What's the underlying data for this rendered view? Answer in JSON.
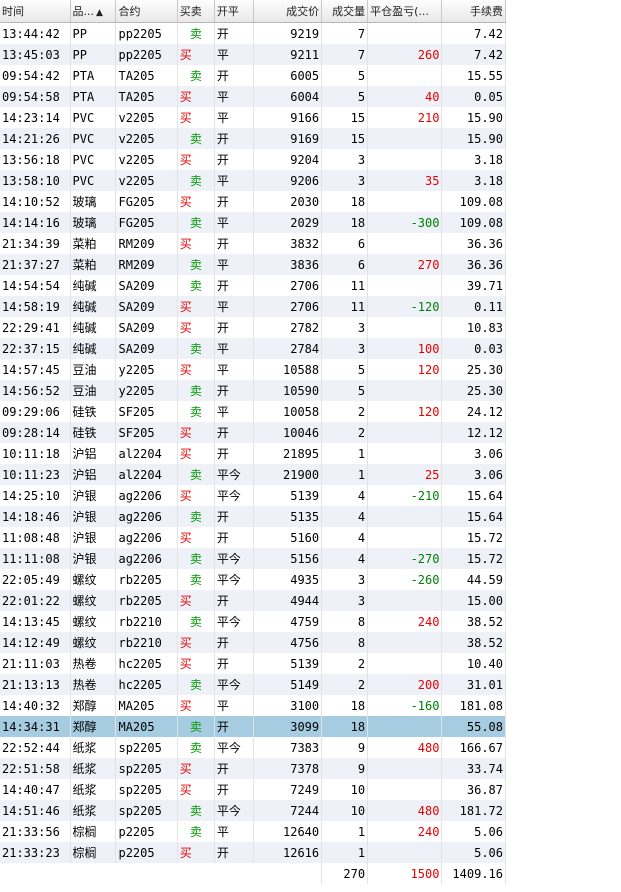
{
  "columns": {
    "time": "时间",
    "product": "品...",
    "contract": "合约",
    "buy_sell": "买卖",
    "open_close": "开平",
    "price": "成交价",
    "volume": "成交量",
    "pnl": "平仓盈亏(...",
    "fee": "手续费"
  },
  "sort_icon": "sort-ascending-icon",
  "rows": [
    {
      "time": "13:44:42",
      "product": "PP",
      "contract": "pp2205",
      "side": "sell",
      "bs": "卖",
      "oc": "开",
      "price": "9219",
      "vol": "7",
      "pnl": "",
      "fee": "7.42"
    },
    {
      "time": "13:45:03",
      "product": "PP",
      "contract": "pp2205",
      "side": "buy",
      "bs": "买",
      "oc": "平",
      "price": "9211",
      "vol": "7",
      "pnl": "260",
      "fee": "7.42"
    },
    {
      "time": "09:54:42",
      "product": "PTA",
      "contract": "TA205",
      "side": "sell",
      "bs": "卖",
      "oc": "开",
      "price": "6005",
      "vol": "5",
      "pnl": "",
      "fee": "15.55"
    },
    {
      "time": "09:54:58",
      "product": "PTA",
      "contract": "TA205",
      "side": "buy",
      "bs": "买",
      "oc": "平",
      "price": "6004",
      "vol": "5",
      "pnl": "40",
      "fee": "0.05"
    },
    {
      "time": "14:23:14",
      "product": "PVC",
      "contract": "v2205",
      "side": "buy",
      "bs": "买",
      "oc": "平",
      "price": "9166",
      "vol": "15",
      "pnl": "210",
      "fee": "15.90"
    },
    {
      "time": "14:21:26",
      "product": "PVC",
      "contract": "v2205",
      "side": "sell",
      "bs": "卖",
      "oc": "开",
      "price": "9169",
      "vol": "15",
      "pnl": "",
      "fee": "15.90"
    },
    {
      "time": "13:56:18",
      "product": "PVC",
      "contract": "v2205",
      "side": "buy",
      "bs": "买",
      "oc": "开",
      "price": "9204",
      "vol": "3",
      "pnl": "",
      "fee": "3.18"
    },
    {
      "time": "13:58:10",
      "product": "PVC",
      "contract": "v2205",
      "side": "sell",
      "bs": "卖",
      "oc": "平",
      "price": "9206",
      "vol": "3",
      "pnl": "35",
      "fee": "3.18"
    },
    {
      "time": "14:10:52",
      "product": "玻璃",
      "contract": "FG205",
      "side": "buy",
      "bs": "买",
      "oc": "开",
      "price": "2030",
      "vol": "18",
      "pnl": "",
      "fee": "109.08"
    },
    {
      "time": "14:14:16",
      "product": "玻璃",
      "contract": "FG205",
      "side": "sell",
      "bs": "卖",
      "oc": "平",
      "price": "2029",
      "vol": "18",
      "pnl": "-300",
      "fee": "109.08"
    },
    {
      "time": "21:34:39",
      "product": "菜粕",
      "contract": "RM209",
      "side": "buy",
      "bs": "买",
      "oc": "开",
      "price": "3832",
      "vol": "6",
      "pnl": "",
      "fee": "36.36"
    },
    {
      "time": "21:37:27",
      "product": "菜粕",
      "contract": "RM209",
      "side": "sell",
      "bs": "卖",
      "oc": "平",
      "price": "3836",
      "vol": "6",
      "pnl": "270",
      "fee": "36.36"
    },
    {
      "time": "14:54:54",
      "product": "纯碱",
      "contract": "SA209",
      "side": "sell",
      "bs": "卖",
      "oc": "开",
      "price": "2706",
      "vol": "11",
      "pnl": "",
      "fee": "39.71"
    },
    {
      "time": "14:58:19",
      "product": "纯碱",
      "contract": "SA209",
      "side": "buy",
      "bs": "买",
      "oc": "平",
      "price": "2706",
      "vol": "11",
      "pnl": "-120",
      "fee": "0.11"
    },
    {
      "time": "22:29:41",
      "product": "纯碱",
      "contract": "SA209",
      "side": "buy",
      "bs": "买",
      "oc": "开",
      "price": "2782",
      "vol": "3",
      "pnl": "",
      "fee": "10.83"
    },
    {
      "time": "22:37:15",
      "product": "纯碱",
      "contract": "SA209",
      "side": "sell",
      "bs": "卖",
      "oc": "平",
      "price": "2784",
      "vol": "3",
      "pnl": "100",
      "fee": "0.03"
    },
    {
      "time": "14:57:45",
      "product": "豆油",
      "contract": "y2205",
      "side": "buy",
      "bs": "买",
      "oc": "平",
      "price": "10588",
      "vol": "5",
      "pnl": "120",
      "fee": "25.30"
    },
    {
      "time": "14:56:52",
      "product": "豆油",
      "contract": "y2205",
      "side": "sell",
      "bs": "卖",
      "oc": "开",
      "price": "10590",
      "vol": "5",
      "pnl": "",
      "fee": "25.30"
    },
    {
      "time": "09:29:06",
      "product": "硅铁",
      "contract": "SF205",
      "side": "sell",
      "bs": "卖",
      "oc": "平",
      "price": "10058",
      "vol": "2",
      "pnl": "120",
      "fee": "24.12"
    },
    {
      "time": "09:28:14",
      "product": "硅铁",
      "contract": "SF205",
      "side": "buy",
      "bs": "买",
      "oc": "开",
      "price": "10046",
      "vol": "2",
      "pnl": "",
      "fee": "12.12"
    },
    {
      "time": "10:11:18",
      "product": "沪铝",
      "contract": "al2204",
      "side": "buy",
      "bs": "买",
      "oc": "开",
      "price": "21895",
      "vol": "1",
      "pnl": "",
      "fee": "3.06"
    },
    {
      "time": "10:11:23",
      "product": "沪铝",
      "contract": "al2204",
      "side": "sell",
      "bs": "卖",
      "oc": "平今",
      "price": "21900",
      "vol": "1",
      "pnl": "25",
      "fee": "3.06"
    },
    {
      "time": "14:25:10",
      "product": "沪银",
      "contract": "ag2206",
      "side": "buy",
      "bs": "买",
      "oc": "平今",
      "price": "5139",
      "vol": "4",
      "pnl": "-210",
      "fee": "15.64"
    },
    {
      "time": "14:18:46",
      "product": "沪银",
      "contract": "ag2206",
      "side": "sell",
      "bs": "卖",
      "oc": "开",
      "price": "5135",
      "vol": "4",
      "pnl": "",
      "fee": "15.64"
    },
    {
      "time": "11:08:48",
      "product": "沪银",
      "contract": "ag2206",
      "side": "buy",
      "bs": "买",
      "oc": "开",
      "price": "5160",
      "vol": "4",
      "pnl": "",
      "fee": "15.72"
    },
    {
      "time": "11:11:08",
      "product": "沪银",
      "contract": "ag2206",
      "side": "sell",
      "bs": "卖",
      "oc": "平今",
      "price": "5156",
      "vol": "4",
      "pnl": "-270",
      "fee": "15.72"
    },
    {
      "time": "22:05:49",
      "product": "螺纹",
      "contract": "rb2205",
      "side": "sell",
      "bs": "卖",
      "oc": "平今",
      "price": "4935",
      "vol": "3",
      "pnl": "-260",
      "fee": "44.59"
    },
    {
      "time": "22:01:22",
      "product": "螺纹",
      "contract": "rb2205",
      "side": "buy",
      "bs": "买",
      "oc": "开",
      "price": "4944",
      "vol": "3",
      "pnl": "",
      "fee": "15.00"
    },
    {
      "time": "14:13:45",
      "product": "螺纹",
      "contract": "rb2210",
      "side": "sell",
      "bs": "卖",
      "oc": "平今",
      "price": "4759",
      "vol": "8",
      "pnl": "240",
      "fee": "38.52"
    },
    {
      "time": "14:12:49",
      "product": "螺纹",
      "contract": "rb2210",
      "side": "buy",
      "bs": "买",
      "oc": "开",
      "price": "4756",
      "vol": "8",
      "pnl": "",
      "fee": "38.52"
    },
    {
      "time": "21:11:03",
      "product": "热卷",
      "contract": "hc2205",
      "side": "buy",
      "bs": "买",
      "oc": "开",
      "price": "5139",
      "vol": "2",
      "pnl": "",
      "fee": "10.40"
    },
    {
      "time": "21:13:13",
      "product": "热卷",
      "contract": "hc2205",
      "side": "sell",
      "bs": "卖",
      "oc": "平今",
      "price": "5149",
      "vol": "2",
      "pnl": "200",
      "fee": "31.01"
    },
    {
      "time": "14:40:32",
      "product": "郑醇",
      "contract": "MA205",
      "side": "buy",
      "bs": "买",
      "oc": "平",
      "price": "3100",
      "vol": "18",
      "pnl": "-160",
      "fee": "181.08"
    },
    {
      "time": "14:34:31",
      "product": "郑醇",
      "contract": "MA205",
      "side": "sell",
      "bs": "卖",
      "oc": "开",
      "price": "3099",
      "vol": "18",
      "pnl": "",
      "fee": "55.08",
      "selected": true
    },
    {
      "time": "22:52:44",
      "product": "纸浆",
      "contract": "sp2205",
      "side": "sell",
      "bs": "卖",
      "oc": "平今",
      "price": "7383",
      "vol": "9",
      "pnl": "480",
      "fee": "166.67"
    },
    {
      "time": "22:51:58",
      "product": "纸浆",
      "contract": "sp2205",
      "side": "buy",
      "bs": "买",
      "oc": "开",
      "price": "7378",
      "vol": "9",
      "pnl": "",
      "fee": "33.74"
    },
    {
      "time": "14:40:47",
      "product": "纸浆",
      "contract": "sp2205",
      "side": "buy",
      "bs": "买",
      "oc": "开",
      "price": "7249",
      "vol": "10",
      "pnl": "",
      "fee": "36.87"
    },
    {
      "time": "14:51:46",
      "product": "纸浆",
      "contract": "sp2205",
      "side": "sell",
      "bs": "卖",
      "oc": "平今",
      "price": "7244",
      "vol": "10",
      "pnl": "480",
      "fee": "181.72"
    },
    {
      "time": "21:33:56",
      "product": "棕榈",
      "contract": "p2205",
      "side": "sell",
      "bs": "卖",
      "oc": "平",
      "price": "12640",
      "vol": "1",
      "pnl": "240",
      "fee": "5.06"
    },
    {
      "time": "21:33:23",
      "product": "棕榈",
      "contract": "p2205",
      "side": "buy",
      "bs": "买",
      "oc": "开",
      "price": "12616",
      "vol": "1",
      "pnl": "",
      "fee": "5.06"
    }
  ],
  "totals": {
    "volume": "270",
    "pnl": "1500",
    "fee": "1409.16"
  },
  "colors": {
    "buy": "#e60000",
    "sell": "#009900",
    "profit": "#e60000",
    "loss": "#008000",
    "selected_row": "#a6cce2"
  }
}
